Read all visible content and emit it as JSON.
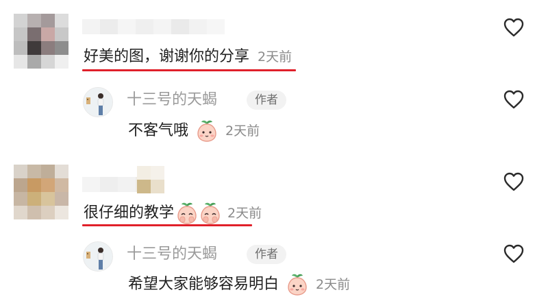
{
  "comments": [
    {
      "text": "好美的图，谢谢你的分享",
      "time": "2天前",
      "reply": {
        "author": "十三号的天蝎",
        "badge": "作者",
        "text": "不客气哦",
        "time": "2天前"
      }
    },
    {
      "text": "很仔细的教学",
      "time": "2天前",
      "reply": {
        "author": "十三号的天蝎",
        "badge": "作者",
        "text": "希望大家能够容易明白",
        "time": "2天前"
      }
    }
  ],
  "icons": {
    "like": "heart-outline-icon",
    "emoji": "peach-face-emoji"
  },
  "colors": {
    "underline": "#e0202a",
    "time": "#8a8a8a",
    "author_name": "#9a9a9a"
  }
}
